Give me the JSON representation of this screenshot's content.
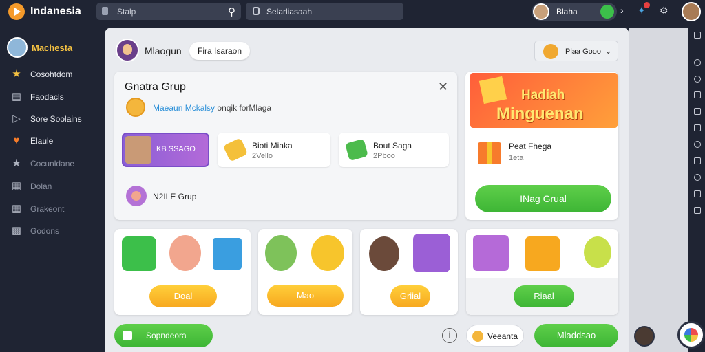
{
  "app": {
    "title": "Indanesia"
  },
  "topbar": {
    "search_text": "Stalp",
    "search2_text": "Selarliasaah",
    "user_name": "Blaha"
  },
  "sidebar": {
    "profile_name": "Machesta",
    "items": [
      {
        "label": "Cosohtdom",
        "icon": "star-icon"
      },
      {
        "label": "Faodacls",
        "icon": "document-icon"
      },
      {
        "label": "Sore Soolains",
        "icon": "play-icon"
      },
      {
        "label": "Elaule",
        "icon": "heart-icon"
      },
      {
        "label": "Cocunldane",
        "icon": "star-outline-icon"
      },
      {
        "label": "Dolan",
        "icon": "chart-icon"
      },
      {
        "label": "Grakeont",
        "icon": "grid-icon"
      },
      {
        "label": "Godons",
        "icon": "people-icon"
      }
    ]
  },
  "main": {
    "header_title": "Mlaogun",
    "header_chip": "Fira Isaraon",
    "dropdown_label": "Plaa Gooo"
  },
  "group_card": {
    "title": "Gnatra Grup",
    "desc_link": "Maeaun Mckalsy",
    "desc_rest": "onqik forMlaga",
    "tile_profile_label": "KB SSAGO",
    "tile_a_title": "Bioti Miaka",
    "tile_a_value": "2Vello",
    "tile_b_title": "Bout Saga",
    "tile_b_value": "2Pboo",
    "group_label": "N2ILE Grup"
  },
  "promo": {
    "banner_line1": "Hadiah",
    "banner_line2": "Minguenan",
    "item_title": "Peat Fhega",
    "item_sub": "1eta",
    "button_label": "INag Grual"
  },
  "bottom_cards": {
    "card1_button": "Doal",
    "card2_button": "Mao",
    "card3_button": "Griial",
    "card4_button": "Riaal"
  },
  "footer": {
    "left_button": "Sopndeora",
    "chip_label": "Veeanta",
    "right_button": "Mladdsao"
  },
  "colors": {
    "sidebar_bg": "#1f2433",
    "accent_green": "#3db535",
    "accent_orange": "#f7a81f",
    "accent_purple": "#8a5fd6"
  }
}
